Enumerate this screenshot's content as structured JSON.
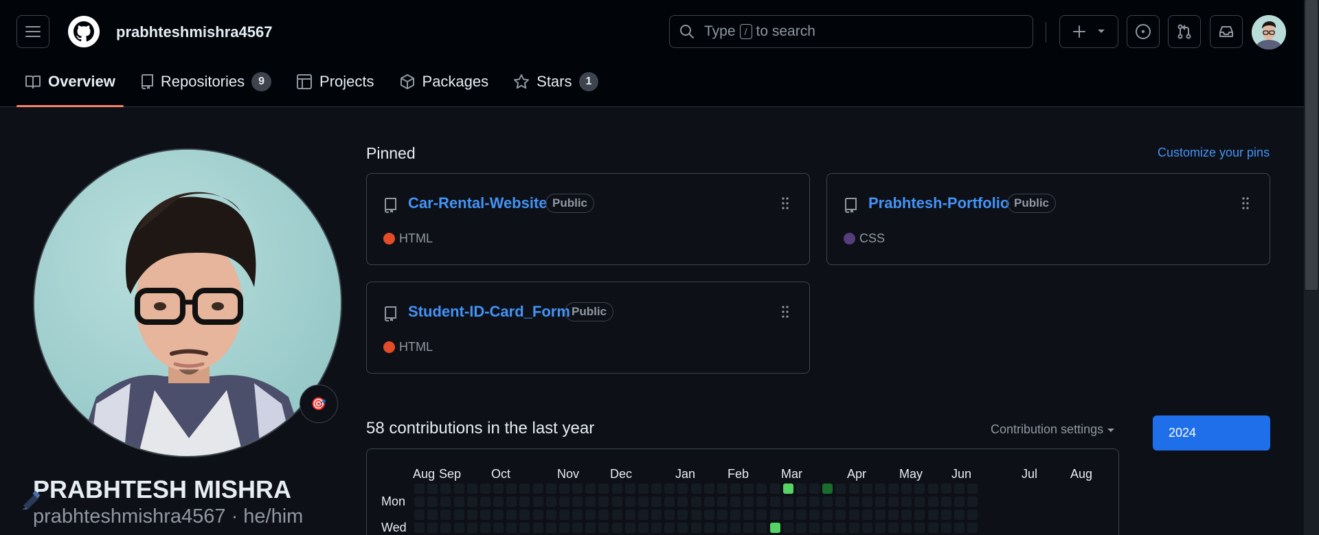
{
  "header": {
    "username": "prabhteshmishra4567",
    "search_before": "Type",
    "search_key": "/",
    "search_after": "to search"
  },
  "tabs": [
    {
      "label": "Overview",
      "icon": "book-icon",
      "count": null,
      "active": true
    },
    {
      "label": "Repositories",
      "icon": "repo-icon",
      "count": "9"
    },
    {
      "label": "Projects",
      "icon": "table-icon",
      "count": null
    },
    {
      "label": "Packages",
      "icon": "package-icon",
      "count": null
    },
    {
      "label": "Stars",
      "icon": "star-icon",
      "count": "1"
    }
  ],
  "profile": {
    "full_name": "PRABHTESH MISHRA",
    "login_line": "prabhteshmishra4567 · he/him",
    "status_emoji": "🎯"
  },
  "pinned": {
    "title": "Pinned",
    "customize_label": "Customize your pins",
    "repos": [
      {
        "name": "Car-Rental-Website",
        "visibility": "Public",
        "language": "HTML",
        "lang_color": "#e34c26"
      },
      {
        "name": "Prabhtesh-Portfolio",
        "visibility": "Public",
        "language": "CSS",
        "lang_color": "#563d7c"
      },
      {
        "name": "Student-ID-Card_Form",
        "visibility": "Public",
        "language": "HTML",
        "lang_color": "#e34c26"
      }
    ]
  },
  "contributions": {
    "title": "58 contributions in the last year",
    "settings_label": "Contribution settings",
    "year": "2024",
    "months": [
      "Aug",
      "Sep",
      "Oct",
      "Nov",
      "Dec",
      "Jan",
      "Feb",
      "Mar",
      "Apr",
      "May",
      "Jun",
      "Jul",
      "Aug"
    ],
    "days": [
      "Mon",
      "Wed"
    ]
  },
  "colors": {
    "accent": "#4493f8",
    "tab_underline": "#f78166",
    "year_button": "#1f6feb",
    "level0": "#151b23",
    "level1": "#033a16",
    "level2": "#196c2e",
    "level4": "#56d364"
  }
}
